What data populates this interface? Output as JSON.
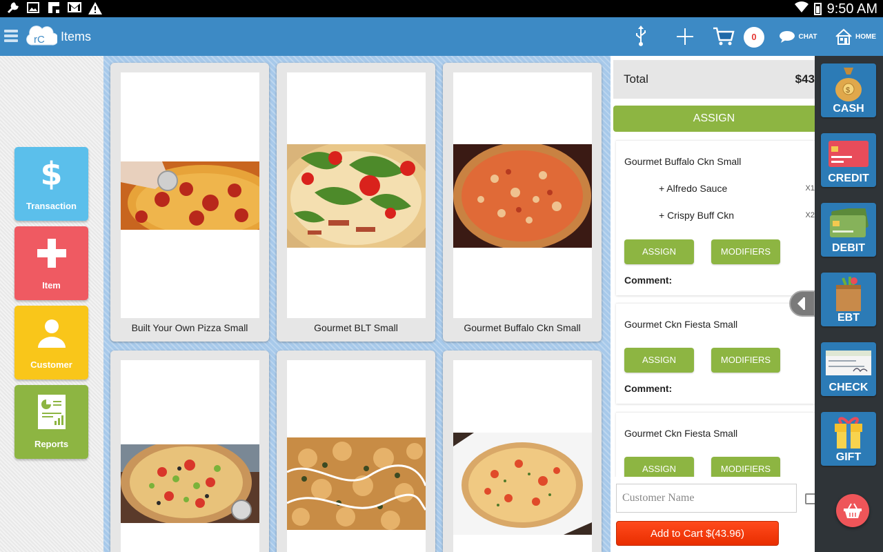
{
  "status_bar": {
    "time": "9:50 AM",
    "icons": [
      "wrench-icon",
      "image-icon",
      "flipboard-icon",
      "gmail-icon",
      "warning-icon",
      "wifi-icon",
      "battery-icon"
    ]
  },
  "app_bar": {
    "logo_text": "rC",
    "title": "Items",
    "cart_count": "0",
    "chat_label": "CHAT",
    "home_label": "HOME"
  },
  "left_nav": [
    {
      "label": "Transaction",
      "icon": "dollar-icon",
      "color": "#5bbfeb"
    },
    {
      "label": "Item",
      "icon": "plus-icon",
      "color": "#ef5a62"
    },
    {
      "label": "Customer",
      "icon": "person-icon",
      "color": "#f9c61a"
    },
    {
      "label": "Reports",
      "icon": "report-icon",
      "color": "#8db542"
    }
  ],
  "items": [
    {
      "name": "Built Your Own Pizza Small",
      "image": "pepperoni-pizza"
    },
    {
      "name": "Gourmet BLT Small",
      "image": "blt-pizza"
    },
    {
      "name": "Gourmet Buffalo Ckn Small",
      "image": "buffalo-pizza"
    },
    {
      "name": "",
      "image": "veggie-pizza"
    },
    {
      "name": "",
      "image": "chicken-ranch-pizza"
    },
    {
      "name": "",
      "image": "tomato-pizza"
    }
  ],
  "cart": {
    "total_label": "Total",
    "total_value": "$43",
    "assign_label": "ASSIGN",
    "line_items": [
      {
        "name": "Gourmet Buffalo Ckn Small",
        "modifiers": [
          {
            "name": "+ Alfredo Sauce",
            "qty": "X1"
          },
          {
            "name": "+ Crispy Buff Ckn",
            "qty": "X2"
          }
        ],
        "assign_label": "ASSIGN",
        "modifiers_label": "MODIFIERS",
        "comment_label": "Comment:"
      },
      {
        "name": "Gourmet Ckn Fiesta Small",
        "modifiers": [],
        "assign_label": "ASSIGN",
        "modifiers_label": "MODIFIERS",
        "comment_label": "Comment:"
      },
      {
        "name": "Gourmet Ckn Fiesta Small",
        "modifiers": [],
        "assign_label": "ASSIGN",
        "modifiers_label": "MODIFIERS",
        "comment_label": ""
      }
    ],
    "customer_placeholder": "Customer Name",
    "add_to_cart_label": "Add to Cart $(43.96)"
  },
  "payment": [
    {
      "label": "CASH",
      "icon": "money-bag-icon"
    },
    {
      "label": "CREDIT",
      "icon": "credit-card-icon"
    },
    {
      "label": "DEBIT",
      "icon": "debit-card-icon"
    },
    {
      "label": "EBT",
      "icon": "grocery-bag-icon"
    },
    {
      "label": "CHECK",
      "icon": "check-icon"
    },
    {
      "label": "GIFT",
      "icon": "gift-icon"
    }
  ],
  "colors": {
    "app_bar": "#3d8ac5",
    "green_button": "#8db542",
    "add_to_cart": "#e92e00",
    "payment_button": "#2c7bb6"
  }
}
